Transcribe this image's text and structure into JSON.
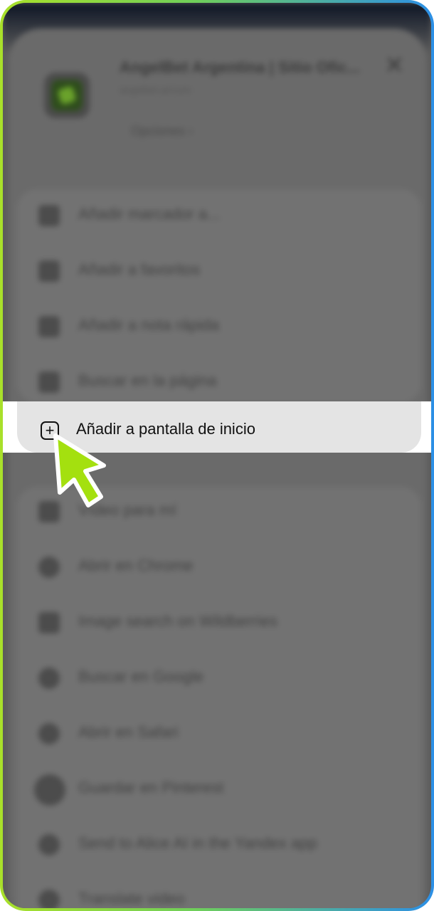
{
  "app": {
    "title": "AngelBet Argentina | Sitio Ofic...",
    "subtitle": "angelbet.ar/com",
    "options_label": "Opciones",
    "close_glyph": "✕"
  },
  "menu_top": [
    {
      "label": "Añadir marcador a...",
      "icon": "book-icon"
    },
    {
      "label": "Añadir a favoritos",
      "icon": "star-icon"
    },
    {
      "label": "Añadir a nota rápida",
      "icon": "note-icon"
    },
    {
      "label": "Buscar en la página",
      "icon": "find-in-page-icon"
    }
  ],
  "highlighted_item": {
    "label": "Añadir a pantalla de inicio",
    "icon": "add-square-icon",
    "glyph": "+"
  },
  "menu_bottom": [
    {
      "label": "Vídeo para mí",
      "icon": "video-icon"
    },
    {
      "label": "Abrir en Chrome",
      "icon": "chrome-icon"
    },
    {
      "label": "Image search on Wildberries",
      "icon": "image-search-icon"
    },
    {
      "label": "Buscar en Google",
      "icon": "google-icon"
    },
    {
      "label": "Abrir en Safari",
      "icon": "safari-icon"
    },
    {
      "label": "Guardar en Pinterest",
      "icon": "pinterest-icon"
    },
    {
      "label": "Send to Alice AI in the Yandex app",
      "icon": "alice-icon"
    },
    {
      "label": "Translate video",
      "icon": "translate-icon"
    }
  ],
  "colors": {
    "frame_gradient_start": "#a9e02a",
    "frame_gradient_end": "#2c8fe6",
    "pointer": "#a4e00f"
  }
}
